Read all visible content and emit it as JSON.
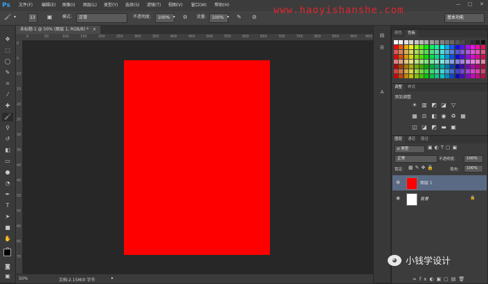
{
  "app": {
    "logo": "Ps"
  },
  "menu": [
    "文件(F)",
    "编辑(E)",
    "图像(I)",
    "图层(L)",
    "类型(Y)",
    "选择(S)",
    "滤镜(T)",
    "视图(V)",
    "窗口(W)",
    "帮助(H)"
  ],
  "window_controls": [
    "—",
    "□",
    "✕"
  ],
  "options_bar": {
    "brush_size": "13",
    "mode_label": "模式:",
    "mode_value": "正常",
    "opacity_label": "不透明度:",
    "opacity_value": "100%",
    "flow_label": "流量:",
    "flow_value": "100%",
    "workspace": "基本功能"
  },
  "watermark": "www.haoyishanshe.com",
  "document": {
    "tab_title": "未标题-1 @ 50% (图层 1, RGB/8) *",
    "canvas_color": "#ff0000"
  },
  "rulers": {
    "h": [
      "0",
      "50",
      "100",
      "150",
      "200",
      "250",
      "300",
      "350",
      "400",
      "450",
      "500",
      "550",
      "600",
      "650",
      "700",
      "750",
      "800",
      "850",
      "900",
      "950"
    ],
    "v": [
      "0",
      "5",
      "10",
      "15",
      "20",
      "25",
      "30",
      "35",
      "40",
      "45",
      "50",
      "55",
      "60",
      "65",
      "70"
    ]
  },
  "status": {
    "zoom": "50%",
    "doc_info": "文档:2.15M/0 字节"
  },
  "panels": {
    "swatches": {
      "tabs": [
        "颜色",
        "色板"
      ],
      "active": 1
    },
    "adjustments": {
      "tabs": [
        "调整",
        "样式"
      ],
      "active": 0,
      "title": "添加调整"
    },
    "layers": {
      "tabs": [
        "图层",
        "通道",
        "路径"
      ],
      "active": 0,
      "filter_label": "ρ 类型",
      "blend_mode": "正常",
      "opacity_label": "不透明度:",
      "opacity_value": "100%",
      "lock_label": "锁定:",
      "fill_label": "填充:",
      "fill_value": "100%",
      "items": [
        {
          "name": "图层 1",
          "thumb_color": "#ff0000",
          "selected": true
        },
        {
          "name": "背景",
          "thumb_color": "#ffffff",
          "selected": false
        }
      ]
    }
  },
  "brand": {
    "text": "小钱学设计"
  }
}
